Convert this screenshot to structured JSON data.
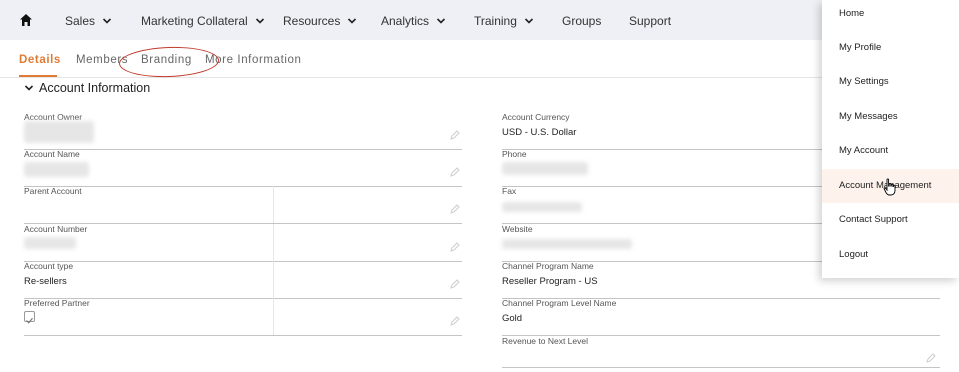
{
  "nav": {
    "home_icon": "home-icon",
    "items": [
      {
        "label": "Sales",
        "has_dropdown": true
      },
      {
        "label": "Marketing Collateral",
        "has_dropdown": true
      },
      {
        "label": "Resources",
        "has_dropdown": true
      },
      {
        "label": "Analytics",
        "has_dropdown": true
      },
      {
        "label": "Training",
        "has_dropdown": true
      },
      {
        "label": "Groups",
        "has_dropdown": false
      },
      {
        "label": "Support",
        "has_dropdown": false
      }
    ]
  },
  "tabs": {
    "items": [
      "Details",
      "Members",
      "Branding",
      "More Information"
    ],
    "active": "Details",
    "highlighted": "Branding"
  },
  "section": {
    "title": "Account Information"
  },
  "fields": {
    "left": [
      {
        "label": "Account Owner",
        "value": ""
      },
      {
        "label": "Account Name",
        "value": ""
      },
      {
        "label": "Parent Account",
        "value": ""
      },
      {
        "label": "Account Number",
        "value": ""
      },
      {
        "label": "Account type",
        "value": "Re-sellers"
      },
      {
        "label": "Preferred Partner",
        "checked": true
      }
    ],
    "right": [
      {
        "label": "Account Currency",
        "value": "USD - U.S. Dollar"
      },
      {
        "label": "Phone",
        "value": ""
      },
      {
        "label": "Fax",
        "value": ""
      },
      {
        "label": "Website",
        "value": ""
      },
      {
        "label": "Channel Program Name",
        "value": "Reseller Program - US"
      },
      {
        "label": "Channel Program Level Name",
        "value": "Gold"
      },
      {
        "label": "Revenue to Next Level",
        "value": ""
      }
    ]
  },
  "user_menu": {
    "items": [
      "Home",
      "My Profile",
      "My Settings",
      "My Messages",
      "My Account",
      "Account Management",
      "Contact Support",
      "Logout"
    ],
    "hovered": "Account Management"
  },
  "colors": {
    "accent": "#e07b35",
    "nav_bg": "#eef0f5",
    "highlight_ring": "#c0392b"
  }
}
